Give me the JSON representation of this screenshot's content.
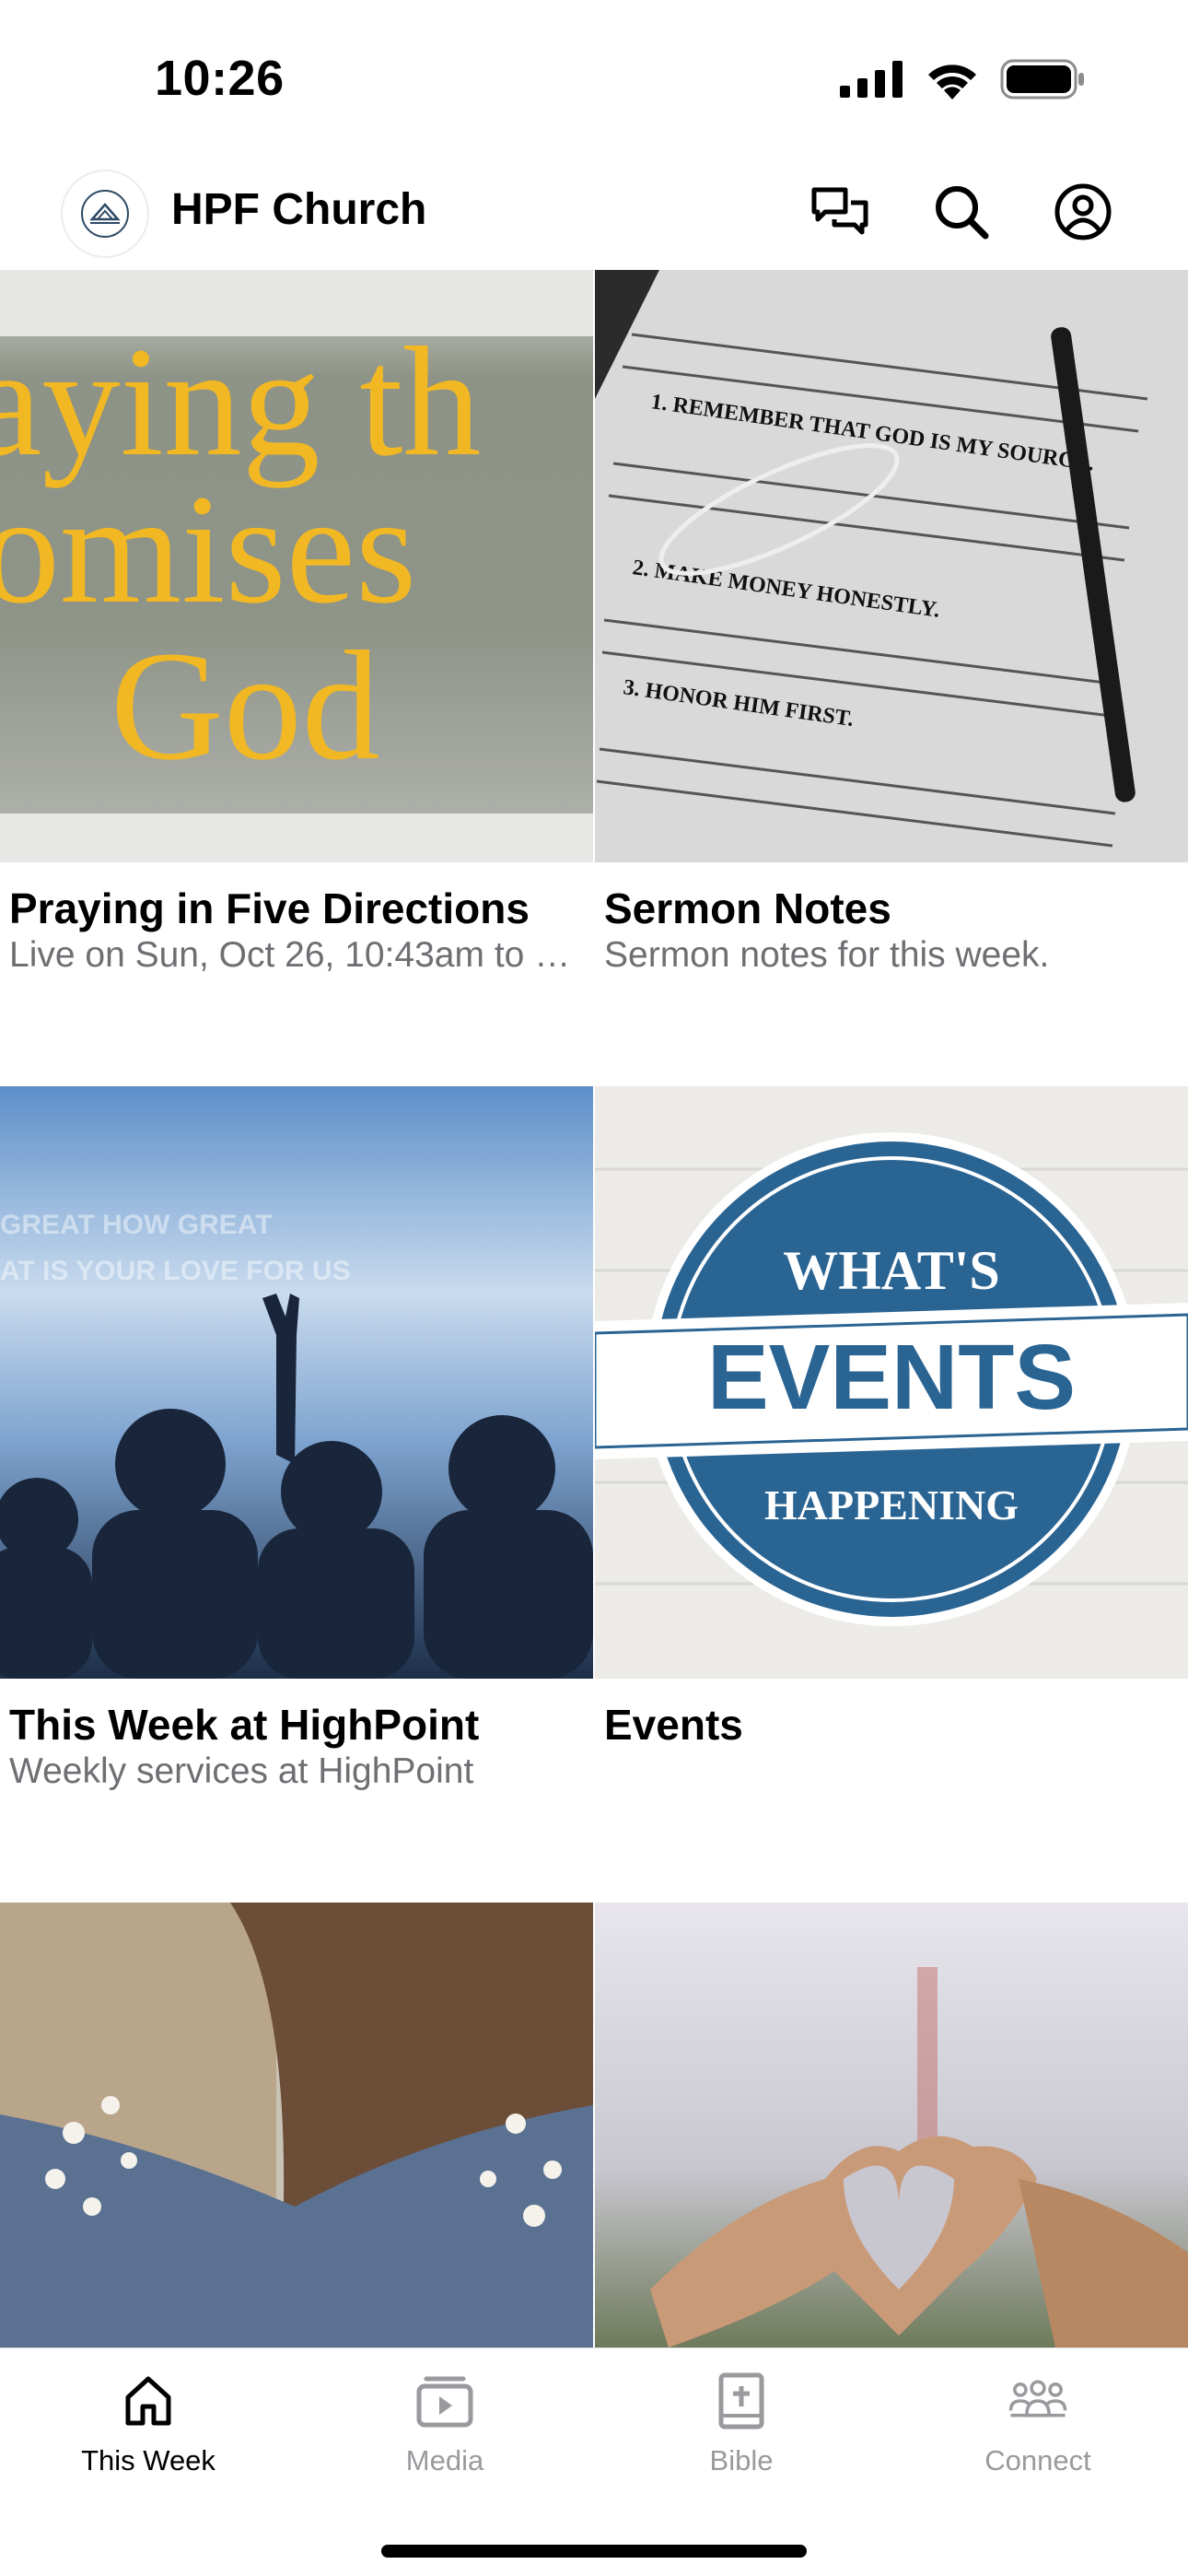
{
  "status_bar": {
    "time": "10:26"
  },
  "header": {
    "title": "HPF Church",
    "icons": [
      "church-logo",
      "chat-icon",
      "search-icon",
      "profile-icon"
    ]
  },
  "cards": [
    {
      "title": "Praying in Five Directions",
      "subtitle": "Live on Sun, Oct 26, 10:43am to 12:00pm",
      "image_text": [
        "aying th",
        "omises",
        "God"
      ]
    },
    {
      "title": "Sermon Notes",
      "subtitle": "Sermon notes for this week.",
      "image_text": [
        "1. REMEMBER THAT GOD IS MY SOURCE.",
        "2. MAKE MONEY HONESTLY.",
        "3. HONOR HIM FIRST."
      ]
    },
    {
      "title": "This Week at HighPoint",
      "subtitle": "Weekly services at HighPoint",
      "image_text": [
        "GREAT HOW GREAT",
        "AT IS YOUR LOVE FOR US"
      ]
    },
    {
      "title": "Events",
      "subtitle": "",
      "image_text": [
        "WHAT'S",
        "EVENTS",
        "HAPPENING"
      ]
    },
    {
      "title": "",
      "subtitle": "",
      "image_text": []
    },
    {
      "title": "",
      "subtitle": "",
      "image_text": []
    }
  ],
  "tabs": [
    {
      "label": "This Week",
      "icon": "home-icon",
      "active": true
    },
    {
      "label": "Media",
      "icon": "media-icon",
      "active": false
    },
    {
      "label": "Bible",
      "icon": "bible-icon",
      "active": false
    },
    {
      "label": "Connect",
      "icon": "connect-icon",
      "active": false
    }
  ],
  "colors": {
    "accent": "#000000",
    "inactive": "#9a9a9e",
    "gold": "#f2b823",
    "events_blue": "#2a6493"
  }
}
